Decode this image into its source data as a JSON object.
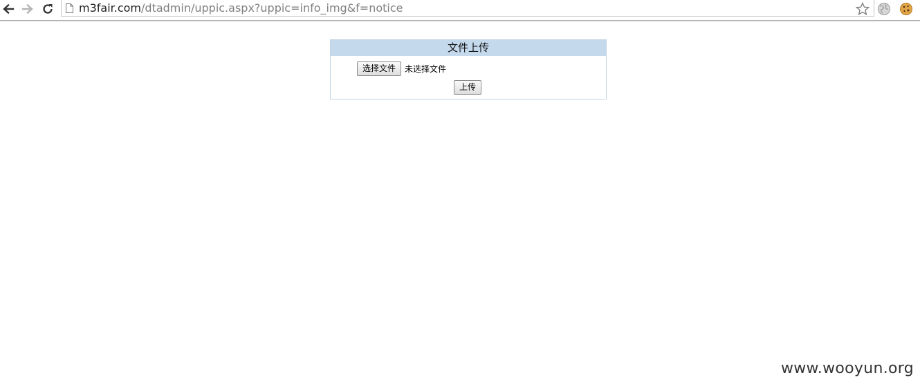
{
  "browser": {
    "url_host": "m3fair.com",
    "url_path": "/dtadmin/uppic.aspx?uppic=info_img&f=notice",
    "icons": {
      "back": "back-arrow-icon",
      "forward": "forward-arrow-icon",
      "reload": "reload-icon",
      "page": "page-icon",
      "bookmark": "star-icon",
      "ext1": "globe-icon",
      "ext2": "cookie-icon"
    }
  },
  "upload_panel": {
    "title": "文件上传",
    "choose_file_label": "选择文件",
    "no_file_text": "未选择文件",
    "upload_label": "上传",
    "header_color": "#c5d9ed"
  },
  "watermark": {
    "text": "www.wooyun.org"
  }
}
